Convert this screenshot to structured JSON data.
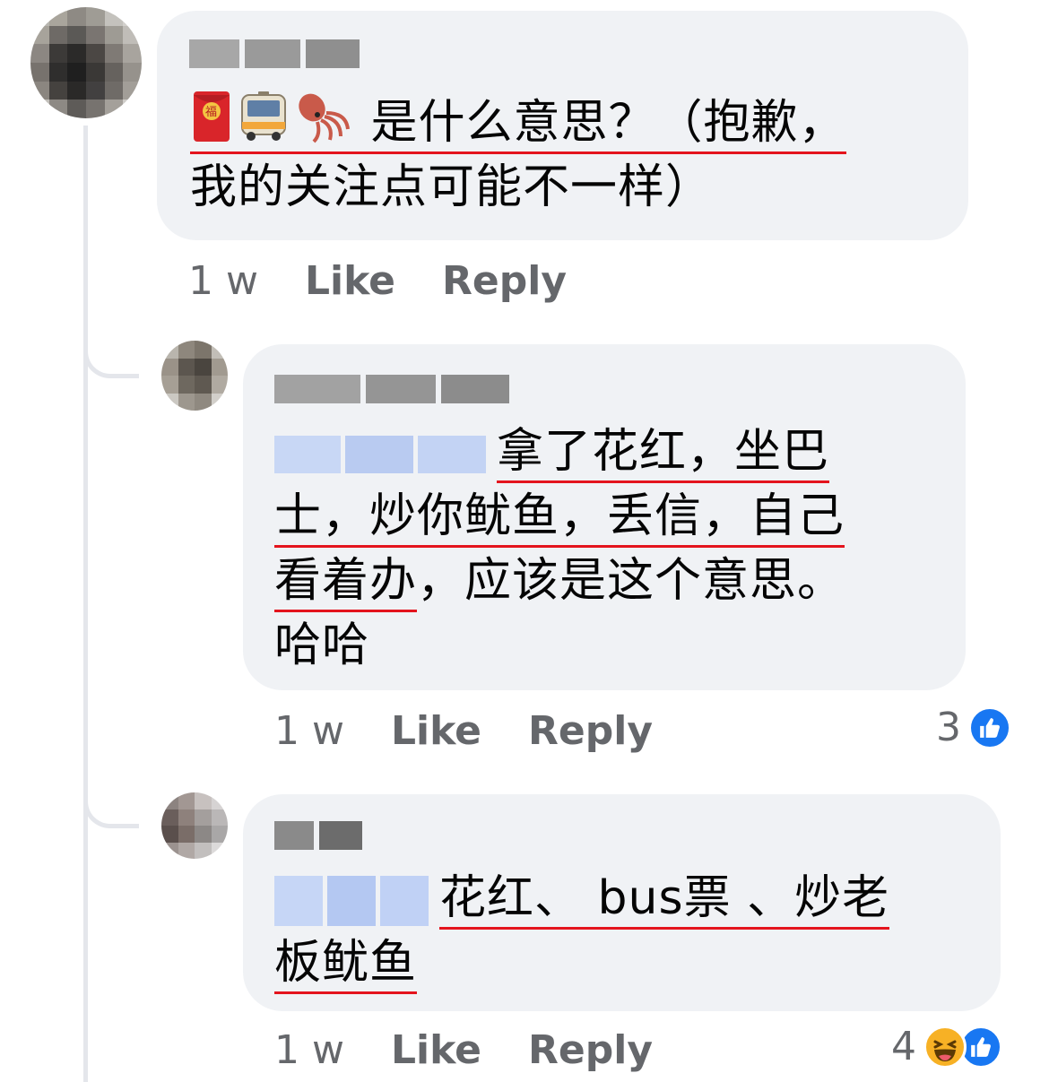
{
  "comment": {
    "author_name": "",
    "text_emoji_part": [
      "red-envelope",
      "bus",
      "squid"
    ],
    "text_underlined": "是什么意思？（抱歉，",
    "text_rest": "我的关注点可能不一样）",
    "time": "1 w",
    "like_label": "Like",
    "reply_label": "Reply"
  },
  "replies": [
    {
      "author_name": "",
      "mention": "",
      "text_line1": "拿了花红，坐巴",
      "text_line2": "士，炒你鱿鱼，丢信，自己",
      "text_line3a": "看着办",
      "text_line3b": "，应该是这个意思。",
      "text_line4": "哈哈",
      "time": "1 w",
      "like_label": "Like",
      "reply_label": "Reply",
      "reaction_count": "3",
      "reactions": [
        "like"
      ]
    },
    {
      "author_name": "",
      "mention": "",
      "text_line1": "花红、 bus票  、炒老",
      "text_line2": "板鱿鱼",
      "time": "1 w",
      "like_label": "Like",
      "reply_label": "Reply",
      "reaction_count": "4",
      "reactions": [
        "haha",
        "like"
      ]
    }
  ],
  "colors": {
    "bubble": "#f0f2f5",
    "meta_text": "#65676b",
    "underline": "#e4141d",
    "like_blue": "#1877f2",
    "haha_yellow": "#f7b125"
  }
}
